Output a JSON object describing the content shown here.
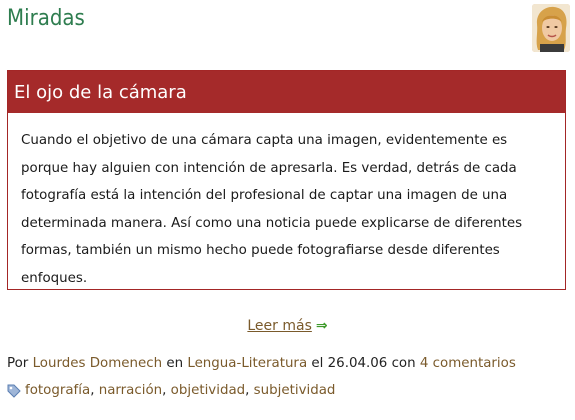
{
  "site": {
    "title": "Miradas"
  },
  "post": {
    "title": "El ojo de la cámara",
    "body": "Cuando el objetivo de una cámara capta una imagen, evidentemente es porque hay alguien con intención de apresarla. Es verdad, detrás de cada fotografía está la intención del profesional de captar una imagen de una determinada manera. Así como una noticia puede explicarse de diferentes formas, también un mismo hecho puede fotografiarse desde diferentes enfoques.",
    "read_more": "Leer más",
    "read_more_icon": "right-arrow-icon"
  },
  "meta": {
    "by": "Por",
    "author": "Lourdes Domenech",
    "in": "en",
    "category": "Lengua-Literatura",
    "the": "el",
    "date": "26.04.06",
    "with": "con",
    "comments": "4 comentarios"
  },
  "tags": {
    "icon": "tag-icon",
    "items": [
      "fotografía",
      "narración",
      "objetividad",
      "subjetividad"
    ],
    "separator": ", "
  },
  "colors": {
    "title_green": "#2e7d4f",
    "header_red": "#a52a2a",
    "link_brown": "#7a5a2b",
    "arrow_green": "#3d9a2a"
  }
}
